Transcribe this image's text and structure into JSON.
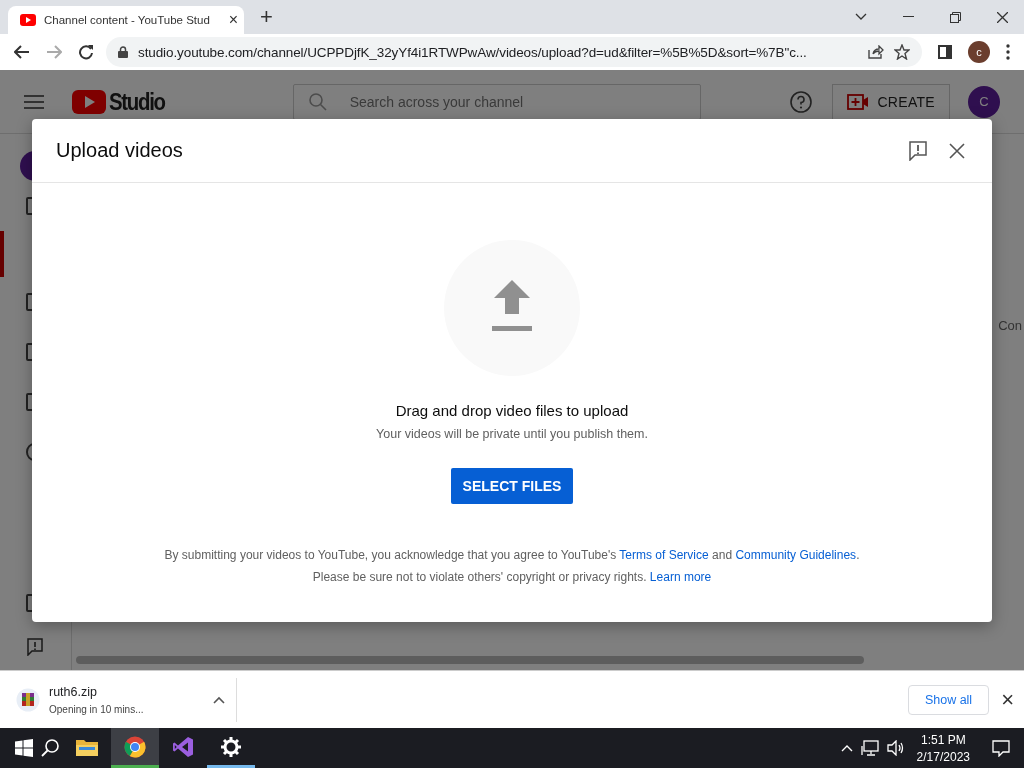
{
  "browser": {
    "tab": {
      "title": "Channel content - YouTube Stud",
      "close": "×"
    },
    "new_tab": "+",
    "url": "studio.youtube.com/channel/UCPPDjfK_32yYf4i1RTWPwAw/videos/upload?d=ud&filter=%5B%5D&sort=%7B\"c...",
    "profile_initial": "c"
  },
  "studio": {
    "logo": "Studio",
    "search": {
      "placeholder": "Search across your channel"
    },
    "create_button": "CREATE",
    "avatar_initial": "C",
    "cut_text": "Con"
  },
  "dialog": {
    "title": "Upload videos",
    "heading": "Drag and drop video files to upload",
    "subtext": "Your videos will be private until you publish them.",
    "button": "SELECT FILES",
    "legal": [
      {
        "parts": [
          {
            "text": "By submitting your videos to YouTube, you acknowledge that you agree to YouTube's ",
            "link": false
          },
          {
            "text": "Terms of Service",
            "link": true
          },
          {
            "text": " and ",
            "link": false
          },
          {
            "text": "Community Guidelines",
            "link": true
          },
          {
            "text": ".",
            "link": false
          }
        ]
      },
      {
        "parts": [
          {
            "text": "Please be sure not to violate others' copyright or privacy rights. ",
            "link": false
          },
          {
            "text": "Learn more",
            "link": true
          }
        ]
      }
    ]
  },
  "download": {
    "file": "ruth6.zip",
    "status": "Opening in 10 mins...",
    "show_all": "Show all",
    "close": "×"
  },
  "taskbar": {
    "apps": [
      {
        "kind": "explorer",
        "selected": false,
        "running": false
      },
      {
        "kind": "chrome",
        "selected": true,
        "running": true
      },
      {
        "kind": "studio",
        "selected": false,
        "running": false
      },
      {
        "kind": "settings",
        "selected": false,
        "running": true
      }
    ],
    "time": "1:51 PM",
    "date": "2/17/2023"
  }
}
